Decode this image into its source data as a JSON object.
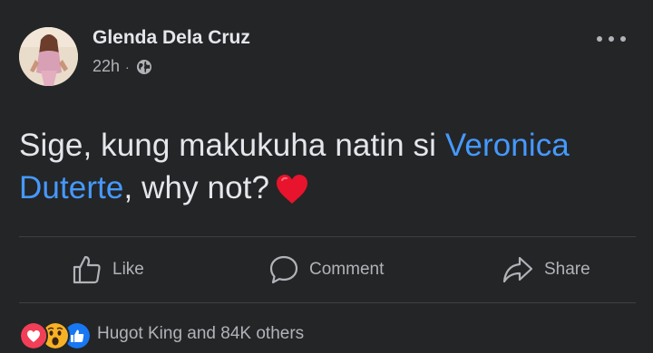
{
  "post": {
    "author": "Glenda Dela Cruz",
    "time": "22h",
    "separator": "·",
    "audience_icon": "globe-icon",
    "menu_icon": "more-options-icon",
    "text_before": "Sige, kung makukuha natin si ",
    "mention": "Veronica Duterte",
    "text_after": ", why not?",
    "emoji": "red-heart"
  },
  "actions": {
    "like_label": "Like",
    "comment_label": "Comment",
    "share_label": "Share"
  },
  "reactions": {
    "icons": [
      "love-reaction-icon",
      "wow-reaction-icon",
      "like-reaction-icon"
    ],
    "summary": "Hugot King and 84K others"
  },
  "colors": {
    "background": "#242526",
    "primary_text": "#e4e6eb",
    "secondary_text": "#b0b3b8",
    "link": "#4599ff",
    "divider": "#3e4042",
    "love": "#f33e58",
    "like": "#1877f2",
    "wow": "#f7b125"
  }
}
